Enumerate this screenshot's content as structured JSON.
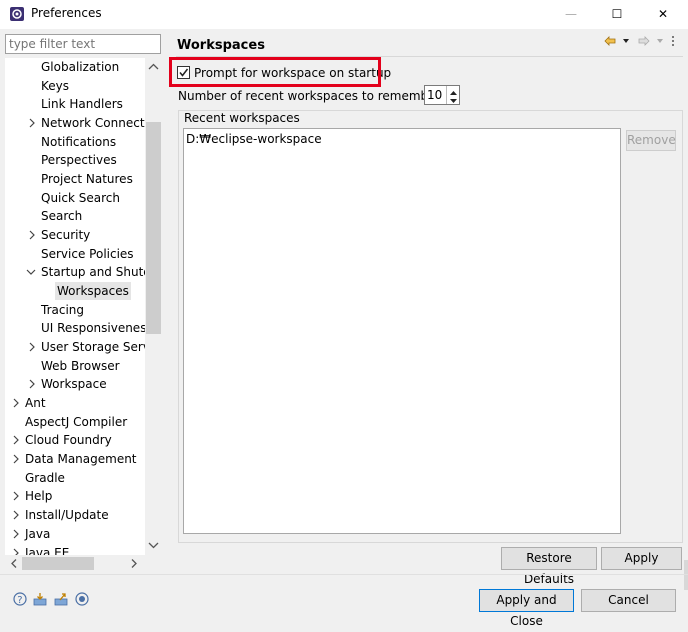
{
  "window": {
    "title": "Preferences",
    "minimize": "—",
    "maximize": "☐",
    "close": "✕"
  },
  "filter": {
    "placeholder": "type filter text"
  },
  "tree": {
    "items": [
      {
        "label": "Globalization"
      },
      {
        "label": "Keys"
      },
      {
        "label": "Link Handlers"
      },
      {
        "label": "Network Connectio"
      },
      {
        "label": "Notifications"
      },
      {
        "label": "Perspectives"
      },
      {
        "label": "Project Natures"
      },
      {
        "label": "Quick Search"
      },
      {
        "label": "Search"
      },
      {
        "label": "Security"
      },
      {
        "label": "Service Policies"
      },
      {
        "label": "Startup and Shutdc"
      },
      {
        "label": "Workspaces"
      },
      {
        "label": "Tracing"
      },
      {
        "label": "UI Responsiveness"
      },
      {
        "label": "User Storage Servic"
      },
      {
        "label": "Web Browser"
      },
      {
        "label": "Workspace"
      },
      {
        "label": "Ant"
      },
      {
        "label": "AspectJ Compiler"
      },
      {
        "label": "Cloud Foundry"
      },
      {
        "label": "Data Management"
      },
      {
        "label": "Gradle"
      },
      {
        "label": "Help"
      },
      {
        "label": "Install/Update"
      },
      {
        "label": "Java"
      },
      {
        "label": "Java EE"
      }
    ]
  },
  "page": {
    "title": "Workspaces",
    "prompt_label": "Prompt for workspace on startup",
    "prompt_checked": true,
    "recent_count_label": "Number of recent workspaces to remember:",
    "recent_count_value": "10",
    "group_label": "Recent workspaces",
    "recent_workspaces": [
      "D:₩eclipse-workspace"
    ],
    "remove_label": "Remove"
  },
  "buttons": {
    "restore_defaults": "Restore Defaults",
    "apply": "Apply",
    "apply_and_close": "Apply and Close",
    "cancel": "Cancel"
  },
  "colors": {
    "highlight": "#e3001b",
    "default_button_border": "#0078d7"
  },
  "icons": [
    "help-icon",
    "import-icon",
    "export-icon",
    "oomph-icon",
    "back-icon",
    "forward-icon",
    "view-menu-icon"
  ]
}
